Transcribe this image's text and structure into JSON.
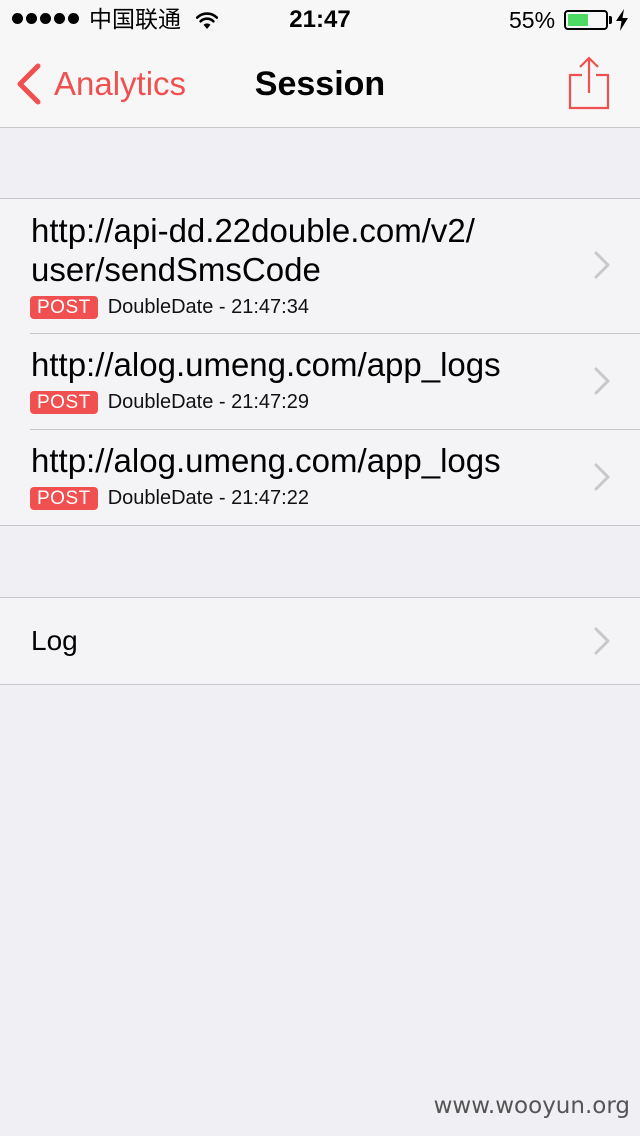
{
  "status_bar": {
    "carrier": "中国联通",
    "time": "21:47",
    "battery_percent": "55%",
    "battery_level": 0.55,
    "battery_color": "#4cd964"
  },
  "nav": {
    "back_label": "Analytics",
    "title": "Session",
    "accent_color": "#f0504f",
    "share_icon": "share-icon"
  },
  "requests": [
    {
      "url": "http://api-dd.22double.com/v2/user/sendSmsCode",
      "url_line1": "http://api-dd.22double.com/v2/",
      "url_line2": "user/sendSmsCode",
      "method": "POST",
      "detail": "DoubleDate - 21:47:34"
    },
    {
      "url": "http://alog.umeng.com/app_logs",
      "method": "POST",
      "detail": "DoubleDate - 21:47:29"
    },
    {
      "url": "http://alog.umeng.com/app_logs",
      "method": "POST",
      "detail": "DoubleDate - 21:47:22"
    }
  ],
  "log_row": {
    "label": "Log"
  },
  "watermark": "www.wooyun.org"
}
